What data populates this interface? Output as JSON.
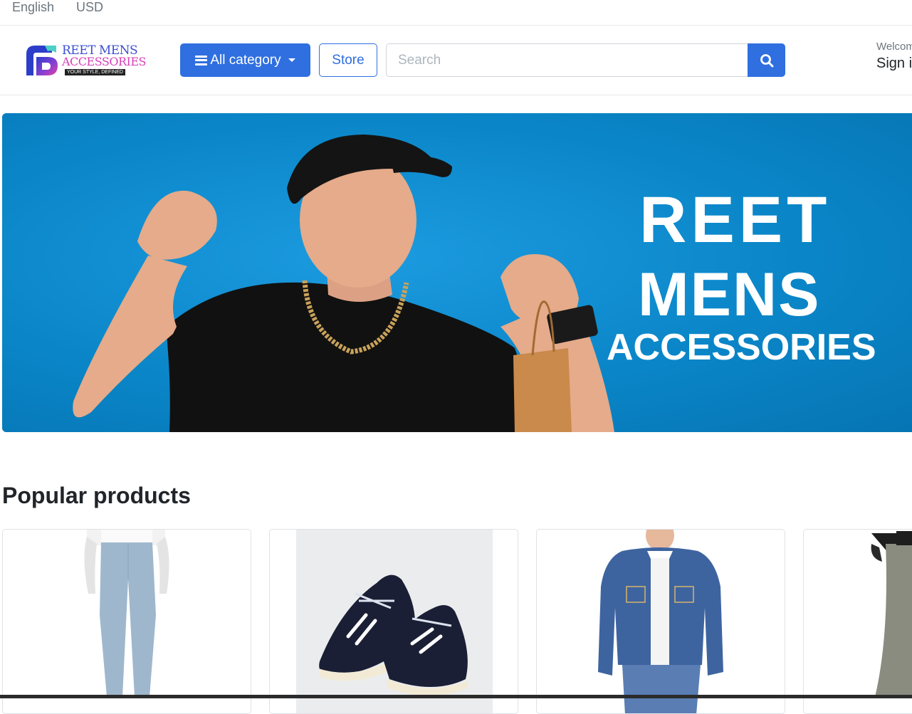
{
  "topbar": {
    "language": "English",
    "currency": "USD"
  },
  "header": {
    "logo": {
      "line1": "REET MENS",
      "line2": "ACCESSORIES",
      "tagline": "YOUR STYLE, DEFINED"
    },
    "category_button": "All category",
    "store_button": "Store",
    "search": {
      "placeholder": "Search",
      "value": ""
    },
    "welcome": "Welcome",
    "signin": "Sign in"
  },
  "banner": {
    "line1": "REET",
    "line2": "MENS",
    "line3": "ACCESSORIES"
  },
  "popular": {
    "title": "Popular products",
    "products": [
      {
        "image": "light-blue-trousers"
      },
      {
        "image": "black-sneakers"
      },
      {
        "image": "denim-jacket"
      },
      {
        "image": "cargo-pants"
      }
    ]
  },
  "colors": {
    "primary": "#2f6fe0",
    "banner": "#0a86c8"
  }
}
